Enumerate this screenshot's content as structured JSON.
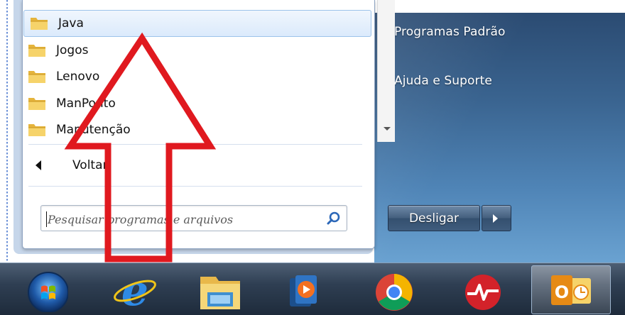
{
  "start_menu": {
    "programs": [
      {
        "label": "Java",
        "selected": true
      },
      {
        "label": "Jogos",
        "selected": false
      },
      {
        "label": "Lenovo",
        "selected": false
      },
      {
        "label": "ManPonto",
        "selected": false
      },
      {
        "label": "Manutenção",
        "selected": false
      }
    ],
    "back_label": "Voltar",
    "search": {
      "placeholder": "Pesquisar programas e arquivos",
      "value": ""
    },
    "right_links": [
      "Programas Padrão",
      "Ajuda e Suporte"
    ],
    "shutdown_label": "Desligar"
  },
  "taskbar": {
    "items": [
      "start-orb-icon",
      "internet-explorer-icon",
      "windows-explorer-icon",
      "media-player-icon",
      "chrome-icon",
      "health-monitor-icon",
      "outlook-icon"
    ],
    "active_item": "outlook-icon"
  },
  "colors": {
    "annotation_arrow": "#e0191f",
    "right_pane": "#3a6490",
    "selection": "#dbeafc"
  }
}
